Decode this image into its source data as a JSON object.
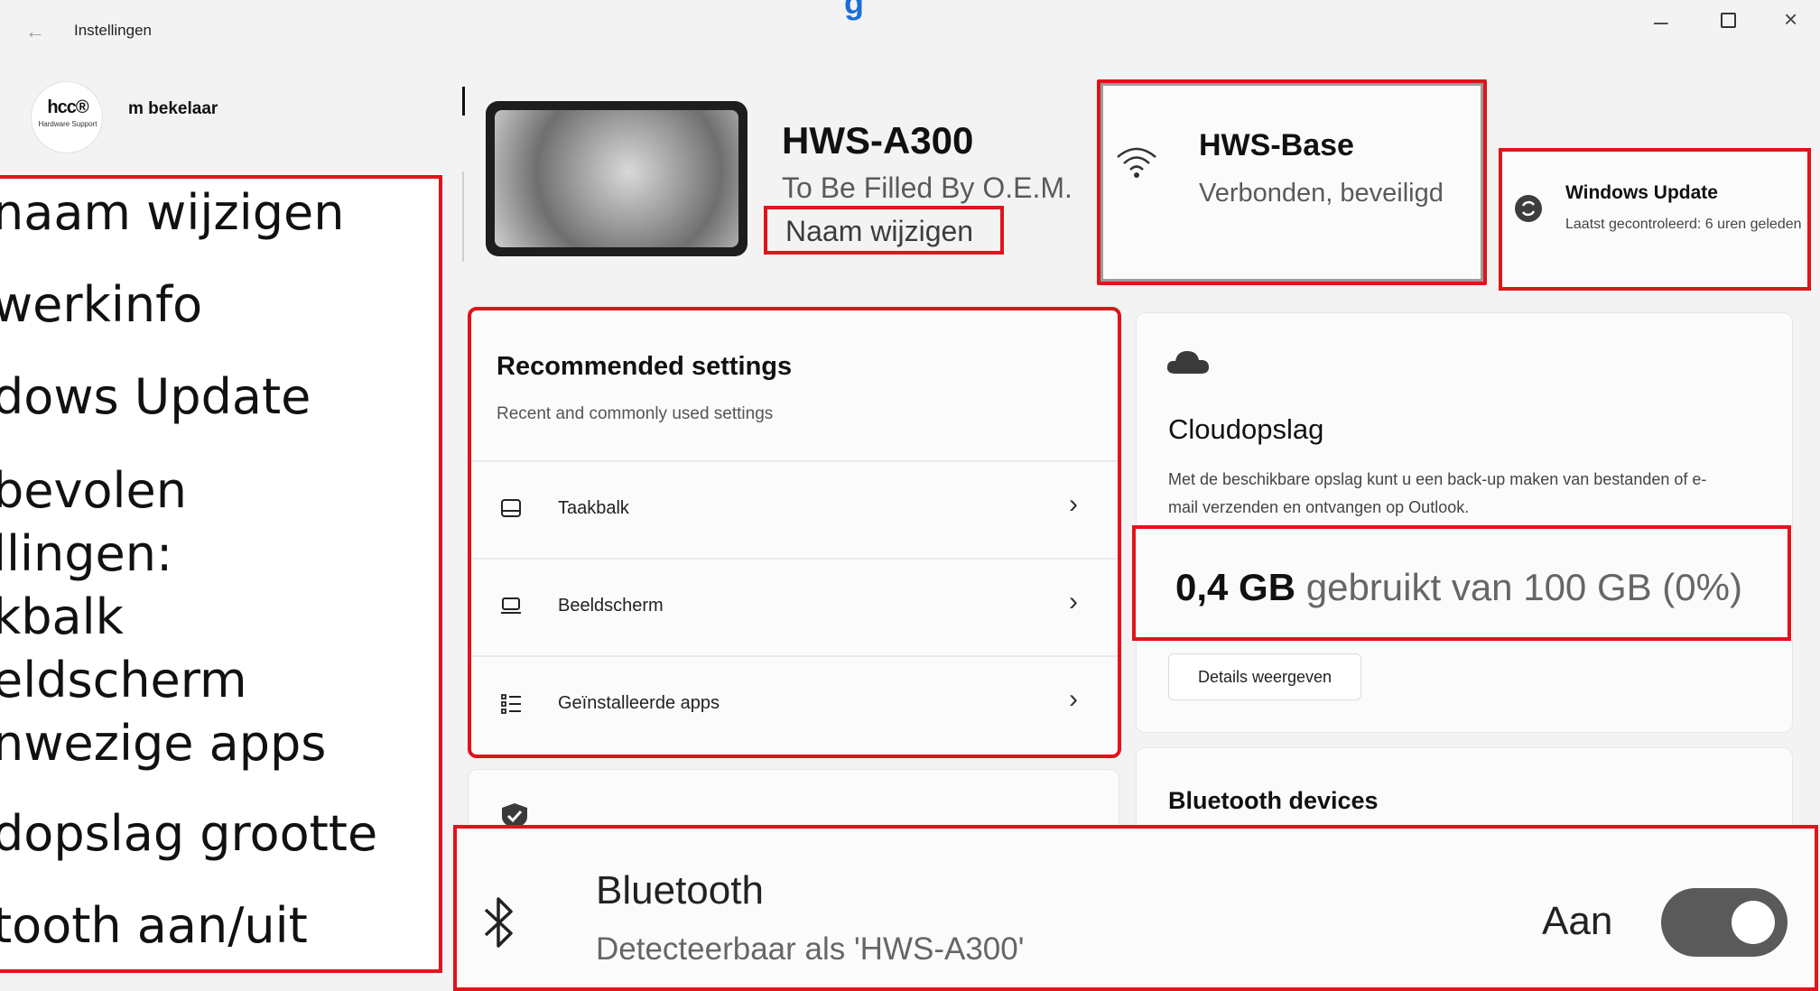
{
  "window": {
    "title": "Instellingen",
    "back_glyph": "←",
    "minimize_glyph": "–",
    "close_glyph": "×",
    "accent_glyph": "g"
  },
  "user": {
    "name": "m bekelaar",
    "avatar_logo": "hcc®",
    "avatar_sub": "Hardware Support"
  },
  "annotations": [
    "naam wijzigen",
    "werkinfo",
    "dows Update",
    "bevolen",
    "llingen:",
    "kbalk",
    "eldscherm",
    "nwezige apps",
    "dopslag grootte",
    "tooth aan/uit"
  ],
  "device": {
    "name": "HWS-A300",
    "manufacturer": "To Be Filled By O.E.M.",
    "rename_label": "Naam wijzigen"
  },
  "network": {
    "name": "HWS-Base",
    "status": "Verbonden, beveiligd",
    "icon": "wifi-icon"
  },
  "windows_update": {
    "title": "Windows Update",
    "status": "Laatst gecontroleerd: 6 uren geleden",
    "icon": "sync-icon"
  },
  "recommended": {
    "title": "Recommended settings",
    "subtitle": "Recent and commonly used settings",
    "items": [
      {
        "label": "Taakbalk",
        "icon": "taskbar-icon"
      },
      {
        "label": "Beeldscherm",
        "icon": "display-icon"
      },
      {
        "label": "Geïnstalleerde apps",
        "icon": "apps-list-icon"
      }
    ],
    "chevron_glyph": "›"
  },
  "cloud": {
    "title": "Cloudopslag",
    "description": "Met de beschikbare opslag kunt u een back-up maken van bestanden of e-mail verzenden en ontvangen op Outlook.",
    "used": "0,4 GB",
    "usage_rest": "gebruikt van 100 GB (0%)",
    "usage_fraction": 0.0,
    "details_button": "Details weergeven"
  },
  "bluetooth_devices": {
    "title": "Bluetooth devices"
  },
  "bluetooth": {
    "title": "Bluetooth",
    "description": "Detecteerbaar als 'HWS-A300'",
    "state_label": "Aan",
    "enabled": true
  },
  "colors": {
    "highlight_red": "#e0141b",
    "background": "#f3f3f3",
    "card": "#fbfbfb",
    "toggle_on": "#5a5a5a"
  }
}
